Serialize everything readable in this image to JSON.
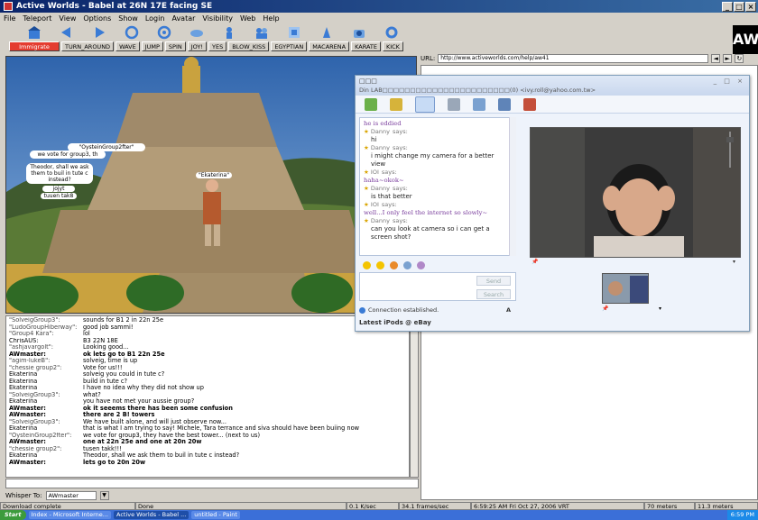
{
  "window": {
    "title": "Active Worlds - Babel at 26N 17E facing SE",
    "buttons": [
      "_",
      "□",
      "×"
    ]
  },
  "menu": [
    "File",
    "Teleport",
    "View",
    "Options",
    "Show",
    "Login",
    "Avatar",
    "Visibility",
    "Web",
    "Help"
  ],
  "toolbar_icons": [
    "home-icon",
    "back-icon",
    "forward-icon",
    "rotate-icon",
    "view-icon",
    "view-icon",
    "binoculars-icon",
    "avatar-icon",
    "users-icon",
    "link-icon",
    "help-icon",
    "camera-icon",
    "settings-icon"
  ],
  "logo_text": "AW",
  "gestures": [
    "Immigrate",
    "TURN_AROUND",
    "WAVE",
    "JUMP",
    "SPIN",
    "JOY!",
    "YES",
    "BLOW_KISS",
    "EGYPTIAN",
    "MACARENA",
    "KARATE",
    "KICK"
  ],
  "scene": {
    "bubbles": [
      "\"OysteinGroup2fter\"",
      "we vote for group3, th",
      "Theodor, shall we ask",
      "them to buil in tute c",
      "instead?",
      "jojyt",
      "tuuen tak8"
    ],
    "avatar_tag": "\"Ekaterina\""
  },
  "chat": [
    {
      "who": "\"SolveigGroup3\":",
      "msg": "sounds for B1 2 in 22n 25e",
      "q": true
    },
    {
      "who": "\"LudoGroupHiberway\":",
      "msg": "good job sammi!",
      "q": true
    },
    {
      "who": "\"Group4 Kara\":",
      "msg": "lol",
      "q": true
    },
    {
      "who": "ChrisAUS:",
      "msg": "B3 22N 18E"
    },
    {
      "who": "\"ashjavargolt\":",
      "msg": "Looking good...",
      "q": true
    },
    {
      "who": "AWmaster:",
      "msg": "ok lets go to B1 22n 25e",
      "bold": true
    },
    {
      "who": "\"agim-lukeB\":",
      "msg": "solveig, time is up",
      "q": true
    },
    {
      "who": "\"chessie group2\":",
      "msg": "Vote for us!!!",
      "q": true
    },
    {
      "who": "Ekaterina",
      "msg": "solveig you could in tute c?"
    },
    {
      "who": "Ekaterina",
      "msg": "build in tute c?"
    },
    {
      "who": "Ekaterina",
      "msg": "I have no idea why they did not show up"
    },
    {
      "who": "\"SolveigGroup3\":",
      "msg": "what?",
      "q": true
    },
    {
      "who": "Ekaterina",
      "msg": "you have not met your aussie group?"
    },
    {
      "who": "AWmaster:",
      "msg": "ok it seeems there has been some confusion",
      "bold": true
    },
    {
      "who": "AWmaster:",
      "msg": "there are 2 B! towers",
      "bold": true
    },
    {
      "who": "\"SolveigGroup3\":",
      "msg": "We have built alone, and will just observe now...",
      "q": true
    },
    {
      "who": "Ekaterina",
      "msg": "that is what I am trying to say! Michele, Tara terrance and siva should have been buiing now"
    },
    {
      "who": "\"OysteinGroup2fter\":",
      "msg": "we vote for group3, they have the best tower... (next to us)",
      "q": true
    },
    {
      "who": "AWmaster:",
      "msg": "one at 22n 25e and one at 20n 20w",
      "bold": true
    },
    {
      "who": "\"chessie group2\":",
      "msg": "tusen takk!!!",
      "q": true
    },
    {
      "who": "Ekaterina",
      "msg": "Theodor, shall we ask them to buil in tute c instead?"
    },
    {
      "who": "AWmaster:",
      "msg": "lets go to 20n 20w",
      "bold": true
    }
  ],
  "whisper": {
    "label": "Whisper To:",
    "value": "AWmaster"
  },
  "status": {
    "left": "Download complete",
    "done": "Done",
    "rate": "0.1 K/sec",
    "fps": "34.1 frames/sec",
    "time": "6:59:25 AM Fri Oct 27, 2006 VRT",
    "dist1": "70 meters",
    "dist2": "11.3 meters"
  },
  "browser": {
    "url_label": "URL:",
    "url": "http://www.activeworlds.com/help/aw41"
  },
  "messenger": {
    "title": "□□□",
    "subtitle": "Din LAB□□□□□□□□□□□□□□□□□□□□□□□(0) <ivy.roll@yahoo.com.tw>",
    "window_btns": "_ □ ×",
    "convo": [
      {
        "type": "me",
        "text": "he is eddied"
      },
      {
        "type": "hdr",
        "name": "Danny",
        "says": "says:"
      },
      {
        "type": "msg",
        "text": "hi"
      },
      {
        "type": "hdr",
        "name": "Danny",
        "says": "says:"
      },
      {
        "type": "msg",
        "text": "i might change my camera for a better view"
      },
      {
        "type": "hdr",
        "name": "IOI",
        "says": "says:"
      },
      {
        "type": "me",
        "text": "haha~okok~"
      },
      {
        "type": "hdr",
        "name": "Danny",
        "says": "says:"
      },
      {
        "type": "msg",
        "text": "is that better"
      },
      {
        "type": "hdr",
        "name": "IOI",
        "says": "says:"
      },
      {
        "type": "me",
        "text": "well...I only feel the internet  so slowly~"
      },
      {
        "type": "hdr",
        "name": "Danny",
        "says": "says:"
      },
      {
        "type": "msg",
        "text": "can you look at camera so i can get a screen shot?"
      }
    ],
    "send": "Send",
    "search": "Search",
    "connection": "Connection established.",
    "ad": "Latest iPods @ eBay",
    "font_btn": "A"
  },
  "taskbar": {
    "start": "Start",
    "tasks": [
      "Index - Microsoft Interne...",
      "Active Worlds - Babel ...",
      "untitled - Paint"
    ],
    "clock": "6:59 PM"
  },
  "colors": {
    "title": "#0a246a",
    "accent": "#e43c30",
    "taskbar": "#3b6fd8"
  }
}
